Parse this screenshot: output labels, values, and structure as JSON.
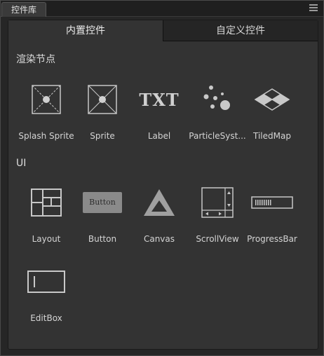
{
  "panel": {
    "title": "控件库"
  },
  "tabs": [
    {
      "label": "内置控件",
      "active": true
    },
    {
      "label": "自定义控件",
      "active": false
    }
  ],
  "sections": [
    {
      "title": "渲染节点",
      "items": [
        {
          "label": "Splash Sprite",
          "icon": "splash-sprite-icon"
        },
        {
          "label": "Sprite",
          "icon": "sprite-icon"
        },
        {
          "label": "Label",
          "icon": "label-icon",
          "icon_text": "TXT"
        },
        {
          "label": "ParticleSyst...",
          "icon": "particle-system-icon"
        },
        {
          "label": "TiledMap",
          "icon": "tiledmap-icon"
        }
      ]
    },
    {
      "title": "UI",
      "items": [
        {
          "label": "Layout",
          "icon": "layout-icon"
        },
        {
          "label": "Button",
          "icon": "button-icon",
          "icon_text": "Button"
        },
        {
          "label": "Canvas",
          "icon": "canvas-icon"
        },
        {
          "label": "ScrollView",
          "icon": "scrollview-icon"
        },
        {
          "label": "ProgressBar",
          "icon": "progressbar-icon"
        },
        {
          "label": "EditBox",
          "icon": "editbox-icon"
        }
      ]
    }
  ],
  "colors": {
    "icon": "#c8c8c8",
    "background": "#333333",
    "tab_inactive": "#252525"
  }
}
